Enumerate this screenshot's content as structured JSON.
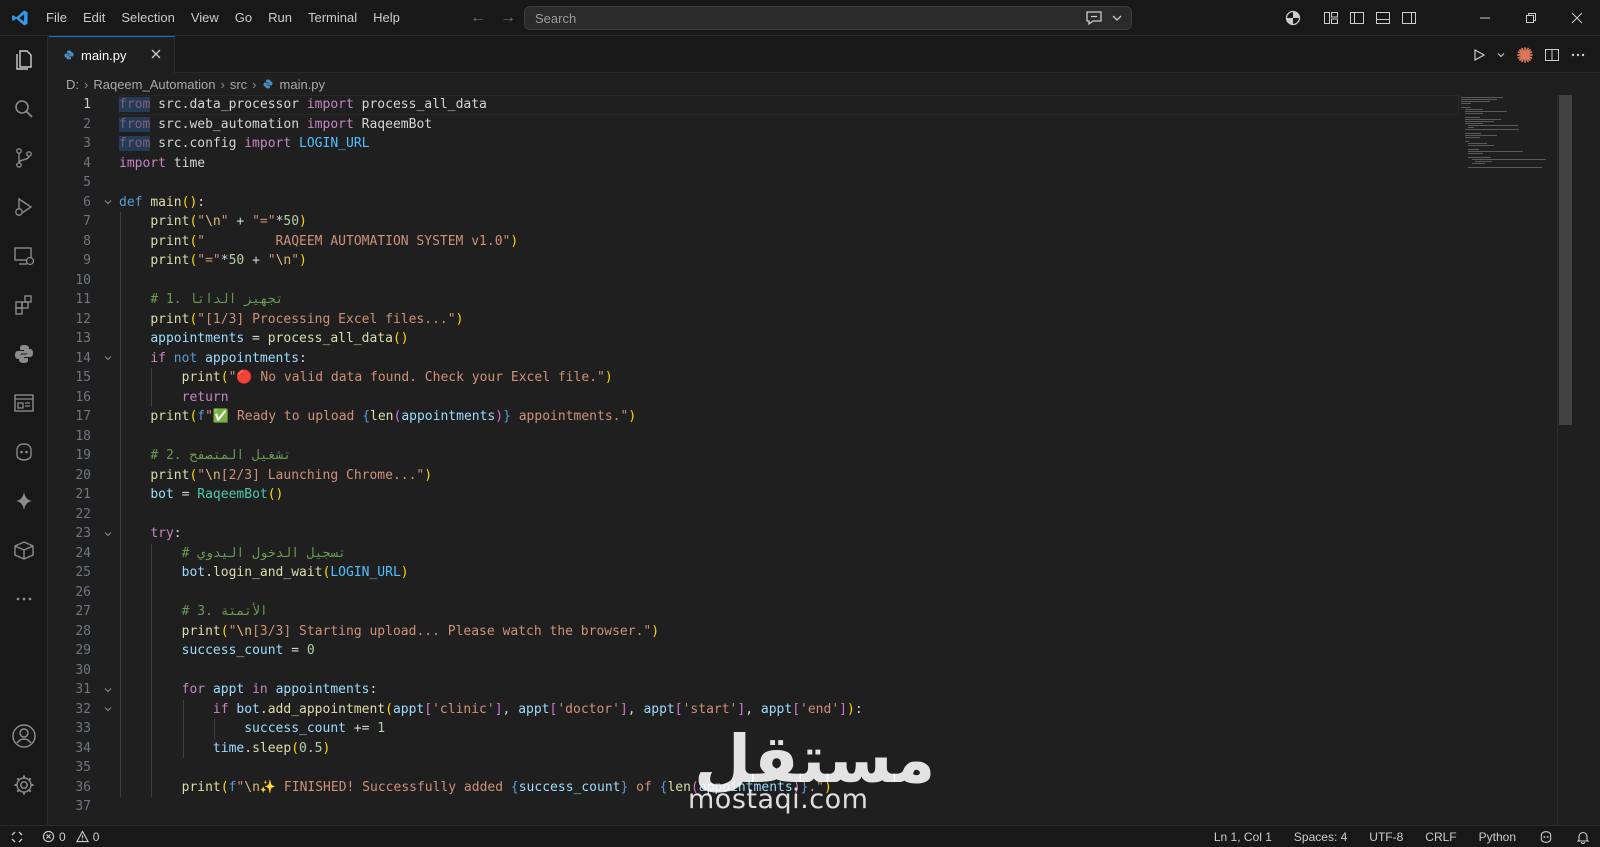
{
  "titlebar": {
    "menu": [
      "File",
      "Edit",
      "Selection",
      "View",
      "Go",
      "Run",
      "Terminal",
      "Help"
    ],
    "search_placeholder": "Search"
  },
  "tab": {
    "label": "main.py"
  },
  "breadcrumb": {
    "drive": "D:",
    "folder": "Raqeem_Automation",
    "subfolder": "src",
    "file": "main.py"
  },
  "editor": {
    "language": "python",
    "lines": [
      [
        [
          "kw",
          "from"
        ],
        [
          "txt",
          " src.data_processor "
        ],
        [
          "kw",
          "import"
        ],
        [
          "txt",
          " process_all_data"
        ]
      ],
      [
        [
          "kw",
          "from"
        ],
        [
          "txt",
          " src.web_automation "
        ],
        [
          "kw",
          "import"
        ],
        [
          "txt",
          " RaqeemBot"
        ]
      ],
      [
        [
          "kw",
          "from"
        ],
        [
          "txt",
          " src.config "
        ],
        [
          "kw",
          "import"
        ],
        [
          "txt",
          " "
        ],
        [
          "const",
          "LOGIN_URL"
        ]
      ],
      [
        [
          "kw",
          "import"
        ],
        [
          "txt",
          " time"
        ]
      ],
      [],
      [
        [
          "def",
          "def"
        ],
        [
          "txt",
          " "
        ],
        [
          "fn",
          "main"
        ],
        [
          "p1",
          "()"
        ],
        [
          "txt",
          ":"
        ]
      ],
      [
        [
          "txt",
          "    "
        ],
        [
          "fn",
          "print"
        ],
        [
          "p1",
          "("
        ],
        [
          "str",
          "\""
        ],
        [
          "esc",
          "\\n"
        ],
        [
          "str",
          "\""
        ],
        [
          "txt",
          " + "
        ],
        [
          "str",
          "\"=\""
        ],
        [
          "txt",
          "*"
        ],
        [
          "num",
          "50"
        ],
        [
          "p1",
          ")"
        ]
      ],
      [
        [
          "txt",
          "    "
        ],
        [
          "fn",
          "print"
        ],
        [
          "p1",
          "("
        ],
        [
          "str",
          "\"         RAQEEM AUTOMATION SYSTEM v1.0\""
        ],
        [
          "p1",
          ")"
        ]
      ],
      [
        [
          "txt",
          "    "
        ],
        [
          "fn",
          "print"
        ],
        [
          "p1",
          "("
        ],
        [
          "str",
          "\"=\""
        ],
        [
          "txt",
          "*"
        ],
        [
          "num",
          "50"
        ],
        [
          "txt",
          " + "
        ],
        [
          "str",
          "\""
        ],
        [
          "esc",
          "\\n"
        ],
        [
          "str",
          "\""
        ],
        [
          "p1",
          ")"
        ]
      ],
      [],
      [
        [
          "txt",
          "    "
        ],
        [
          "cmt",
          "# 1. تجهيز الداتا"
        ]
      ],
      [
        [
          "txt",
          "    "
        ],
        [
          "fn",
          "print"
        ],
        [
          "p1",
          "("
        ],
        [
          "str",
          "\"[1/3] Processing Excel files...\""
        ],
        [
          "p1",
          ")"
        ]
      ],
      [
        [
          "txt",
          "    "
        ],
        [
          "var",
          "appointments"
        ],
        [
          "txt",
          " = "
        ],
        [
          "fn",
          "process_all_data"
        ],
        [
          "p1",
          "()"
        ]
      ],
      [
        [
          "txt",
          "    "
        ],
        [
          "kw",
          "if"
        ],
        [
          "txt",
          " "
        ],
        [
          "def",
          "not"
        ],
        [
          "txt",
          " "
        ],
        [
          "var",
          "appointments"
        ],
        [
          "txt",
          ":"
        ]
      ],
      [
        [
          "txt",
          "        "
        ],
        [
          "fn",
          "print"
        ],
        [
          "p1",
          "("
        ],
        [
          "str",
          "\"🔴 No valid data found. Check your Excel file.\""
        ],
        [
          "p1",
          ")"
        ]
      ],
      [
        [
          "txt",
          "        "
        ],
        [
          "kw",
          "return"
        ]
      ],
      [
        [
          "txt",
          "    "
        ],
        [
          "fn",
          "print"
        ],
        [
          "p1",
          "("
        ],
        [
          "def",
          "f"
        ],
        [
          "str",
          "\"✅ Ready to upload "
        ],
        [
          "def",
          "{"
        ],
        [
          "fn",
          "len"
        ],
        [
          "p2",
          "("
        ],
        [
          "var",
          "appointments"
        ],
        [
          "p2",
          ")"
        ],
        [
          "def",
          "}"
        ],
        [
          "str",
          " appointments.\""
        ],
        [
          "p1",
          ")"
        ]
      ],
      [],
      [
        [
          "txt",
          "    "
        ],
        [
          "cmt",
          "# 2. تشغيل المتصفح"
        ]
      ],
      [
        [
          "txt",
          "    "
        ],
        [
          "fn",
          "print"
        ],
        [
          "p1",
          "("
        ],
        [
          "str",
          "\""
        ],
        [
          "esc",
          "\\n"
        ],
        [
          "str",
          "[2/3] Launching Chrome...\""
        ],
        [
          "p1",
          ")"
        ]
      ],
      [
        [
          "txt",
          "    "
        ],
        [
          "var",
          "bot"
        ],
        [
          "txt",
          " = "
        ],
        [
          "cls",
          "RaqeemBot"
        ],
        [
          "p1",
          "()"
        ]
      ],
      [],
      [
        [
          "txt",
          "    "
        ],
        [
          "kw",
          "try"
        ],
        [
          "txt",
          ":"
        ]
      ],
      [
        [
          "txt",
          "        "
        ],
        [
          "cmt",
          "# تسجيل الدخول اليدوي"
        ]
      ],
      [
        [
          "txt",
          "        "
        ],
        [
          "var",
          "bot"
        ],
        [
          "txt",
          "."
        ],
        [
          "fn",
          "login_and_wait"
        ],
        [
          "p1",
          "("
        ],
        [
          "const",
          "LOGIN_URL"
        ],
        [
          "p1",
          ")"
        ]
      ],
      [],
      [
        [
          "txt",
          "        "
        ],
        [
          "cmt",
          "# 3. الأتمتة"
        ]
      ],
      [
        [
          "txt",
          "        "
        ],
        [
          "fn",
          "print"
        ],
        [
          "p1",
          "("
        ],
        [
          "str",
          "\""
        ],
        [
          "esc",
          "\\n"
        ],
        [
          "str",
          "[3/3] Starting upload... Please watch the browser.\""
        ],
        [
          "p1",
          ")"
        ]
      ],
      [
        [
          "txt",
          "        "
        ],
        [
          "var",
          "success_count"
        ],
        [
          "txt",
          " = "
        ],
        [
          "num",
          "0"
        ]
      ],
      [],
      [
        [
          "txt",
          "        "
        ],
        [
          "kw",
          "for"
        ],
        [
          "txt",
          " "
        ],
        [
          "var",
          "appt"
        ],
        [
          "txt",
          " "
        ],
        [
          "kw",
          "in"
        ],
        [
          "txt",
          " "
        ],
        [
          "var",
          "appointments"
        ],
        [
          "txt",
          ":"
        ]
      ],
      [
        [
          "txt",
          "            "
        ],
        [
          "kw",
          "if"
        ],
        [
          "txt",
          " "
        ],
        [
          "var",
          "bot"
        ],
        [
          "txt",
          "."
        ],
        [
          "fn",
          "add_appointment"
        ],
        [
          "p1",
          "("
        ],
        [
          "var",
          "appt"
        ],
        [
          "p2",
          "["
        ],
        [
          "str",
          "'clinic'"
        ],
        [
          "p2",
          "]"
        ],
        [
          "txt",
          ", "
        ],
        [
          "var",
          "appt"
        ],
        [
          "p2",
          "["
        ],
        [
          "str",
          "'doctor'"
        ],
        [
          "p2",
          "]"
        ],
        [
          "txt",
          ", "
        ],
        [
          "var",
          "appt"
        ],
        [
          "p2",
          "["
        ],
        [
          "str",
          "'start'"
        ],
        [
          "p2",
          "]"
        ],
        [
          "txt",
          ", "
        ],
        [
          "var",
          "appt"
        ],
        [
          "p2",
          "["
        ],
        [
          "str",
          "'end'"
        ],
        [
          "p2",
          "]"
        ],
        [
          "p1",
          ")"
        ],
        [
          "txt",
          ":"
        ]
      ],
      [
        [
          "txt",
          "                "
        ],
        [
          "var",
          "success_count"
        ],
        [
          "txt",
          " += "
        ],
        [
          "num",
          "1"
        ]
      ],
      [
        [
          "txt",
          "            "
        ],
        [
          "var",
          "time"
        ],
        [
          "txt",
          "."
        ],
        [
          "fn",
          "sleep"
        ],
        [
          "p1",
          "("
        ],
        [
          "num",
          "0.5"
        ],
        [
          "p1",
          ")"
        ]
      ],
      [],
      [
        [
          "txt",
          "        "
        ],
        [
          "fn",
          "print"
        ],
        [
          "p1",
          "("
        ],
        [
          "def",
          "f"
        ],
        [
          "str",
          "\""
        ],
        [
          "esc",
          "\\n"
        ],
        [
          "str",
          "✨ FINISHED! Successfully added "
        ],
        [
          "def",
          "{"
        ],
        [
          "var",
          "success_count"
        ],
        [
          "def",
          "}"
        ],
        [
          "str",
          " of "
        ],
        [
          "def",
          "{"
        ],
        [
          "fn",
          "len"
        ],
        [
          "p2",
          "("
        ],
        [
          "var",
          "appointments"
        ],
        [
          "p2",
          ")"
        ],
        [
          "def",
          "}"
        ],
        [
          "str",
          ".\""
        ],
        [
          "p1",
          ")"
        ]
      ],
      []
    ]
  },
  "watermark": {
    "arabic": "مستقل",
    "latin": "mostaqi.com"
  },
  "statusbar": {
    "errors": "0",
    "warnings": "0",
    "position": "Ln 1, Col 1",
    "spaces": "Spaces: 4",
    "encoding": "UTF-8",
    "eol": "CRLF",
    "language": "Python"
  },
  "colors": {
    "accent": "#0078d4",
    "editor_bg": "#1f1f1f",
    "chrome_bg": "#181818"
  }
}
